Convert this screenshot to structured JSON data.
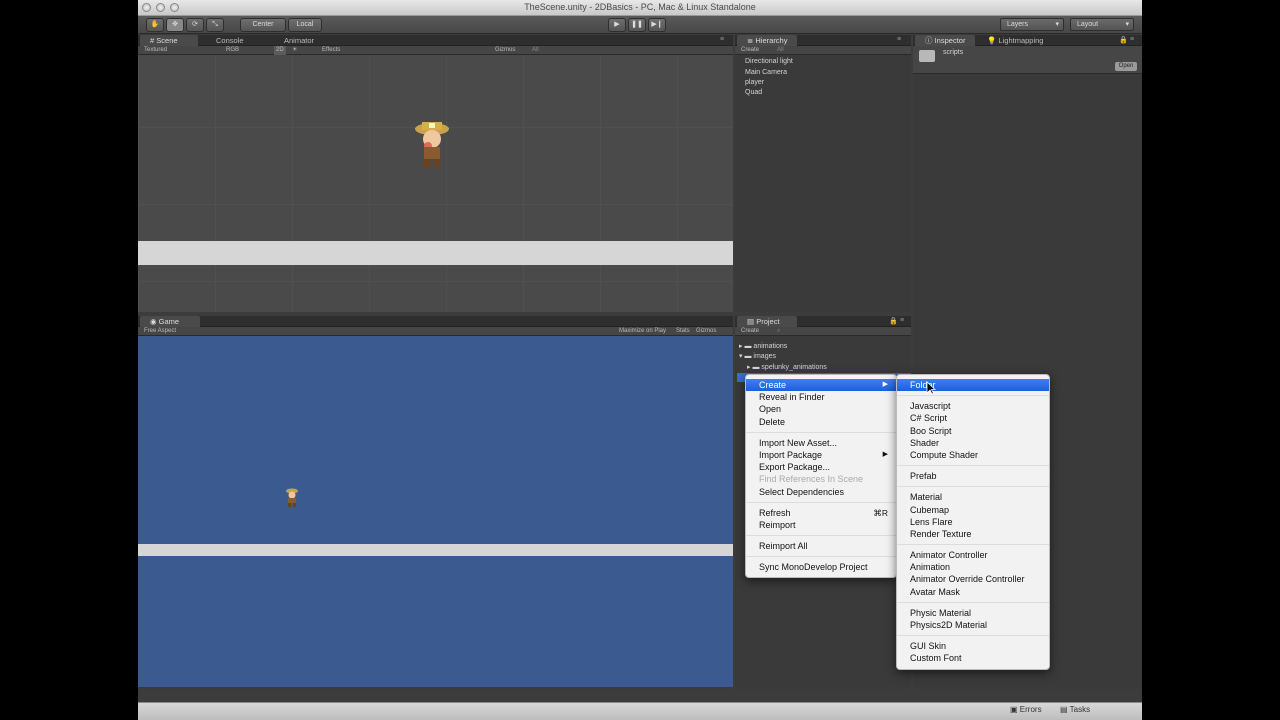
{
  "window": {
    "title": "TheScene.unity - 2DBasics - PC, Mac & Linux Standalone"
  },
  "toolbar": {
    "tools": [
      "hand-icon",
      "move-icon",
      "rotate-icon",
      "scale-icon"
    ],
    "center_label": "Center",
    "local_label": "Local",
    "play_controls": [
      "play-icon",
      "pause-icon",
      "step-icon"
    ],
    "layers_label": "Layers",
    "layout_label": "Layout"
  },
  "scene_panel": {
    "tabs": [
      "Scene",
      "Console",
      "Animator"
    ],
    "shading_mode": "Textured",
    "render_mode": "RGB",
    "mode_2d": "2D",
    "effects_label": "Effects",
    "gizmos_label": "Gizmos",
    "search_placeholder": "All"
  },
  "game_panel": {
    "tab": "Game",
    "aspect": "Free Aspect",
    "maximize_label": "Maximize on Play",
    "stats_label": "Stats",
    "gizmos_label": "Gizmos"
  },
  "hierarchy": {
    "tab": "Hierarchy",
    "create_label": "Create",
    "search_placeholder": "All",
    "items": [
      "Directional light",
      "Main Camera",
      "player",
      "Quad"
    ]
  },
  "inspector": {
    "tabs": [
      "Inspector",
      "Lightmapping"
    ],
    "asset_name": "scripts",
    "open_label": "Open"
  },
  "project": {
    "tab": "Project",
    "create_label": "Create",
    "folders": [
      "animations",
      "images",
      "spelunky_animations"
    ]
  },
  "context_menu": {
    "items": [
      {
        "label": "Create",
        "highlight": true,
        "submenu": true
      },
      {
        "label": "Reveal in Finder"
      },
      {
        "label": "Open"
      },
      {
        "label": "Delete"
      },
      {
        "sep": true
      },
      {
        "label": "Import New Asset..."
      },
      {
        "label": "Import Package",
        "submenu": true
      },
      {
        "label": "Export Package..."
      },
      {
        "label": "Find References In Scene",
        "disabled": true
      },
      {
        "label": "Select Dependencies"
      },
      {
        "sep": true
      },
      {
        "label": "Refresh",
        "shortcut": "⌘R"
      },
      {
        "label": "Reimport"
      },
      {
        "sep": true
      },
      {
        "label": "Reimport All"
      },
      {
        "sep": true
      },
      {
        "label": "Sync MonoDevelop Project"
      }
    ]
  },
  "create_submenu": {
    "items": [
      {
        "label": "Folder",
        "highlight": true
      },
      {
        "sep": true
      },
      {
        "label": "Javascript"
      },
      {
        "label": "C# Script"
      },
      {
        "label": "Boo Script"
      },
      {
        "label": "Shader"
      },
      {
        "label": "Compute Shader"
      },
      {
        "sep": true
      },
      {
        "label": "Prefab"
      },
      {
        "sep": true
      },
      {
        "label": "Material"
      },
      {
        "label": "Cubemap"
      },
      {
        "label": "Lens Flare"
      },
      {
        "label": "Render Texture"
      },
      {
        "sep": true
      },
      {
        "label": "Animator Controller"
      },
      {
        "label": "Animation"
      },
      {
        "label": "Animator Override Controller"
      },
      {
        "label": "Avatar Mask"
      },
      {
        "sep": true
      },
      {
        "label": "Physic Material"
      },
      {
        "label": "Physics2D Material"
      },
      {
        "sep": true
      },
      {
        "label": "GUI Skin"
      },
      {
        "label": "Custom Font"
      }
    ]
  },
  "statusbar": {
    "errors_label": "Errors",
    "tasks_label": "Tasks"
  }
}
